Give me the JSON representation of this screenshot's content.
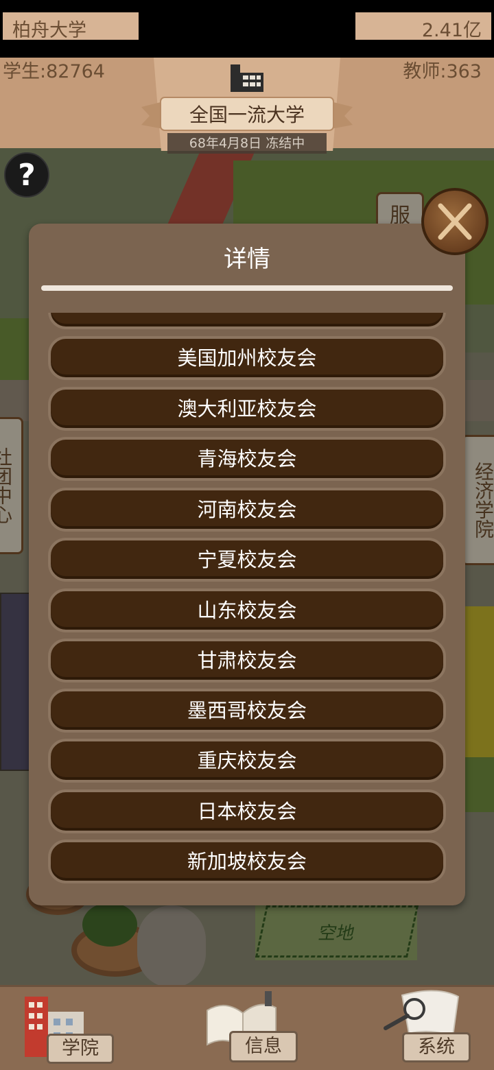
{
  "hud": {
    "university_name": "柏舟大学",
    "money": "2.41亿",
    "students": "学生:82764",
    "teachers": "教师:363",
    "rank": "全国一流大学",
    "date_status": "68年4月8日 冻结中"
  },
  "help_label": "?",
  "map_signs": {
    "sign_top": "服",
    "sign_left": "社团中心",
    "sign_right": "经济学院",
    "plot": "空地"
  },
  "modal": {
    "title": "详情",
    "items": [
      "",
      "美国加州校友会",
      "澳大利亚校友会",
      "青海校友会",
      "河南校友会",
      "宁夏校友会",
      "山东校友会",
      "甘肃校友会",
      "墨西哥校友会",
      "重庆校友会",
      "日本校友会",
      "新加坡校友会"
    ]
  },
  "bottom_nav": {
    "college": "学院",
    "info": "信息",
    "system": "系统"
  },
  "colors": {
    "hud_bg": "#c49b79",
    "modal_bg": "#7b6450",
    "item_bg": "#412710",
    "nav_bg": "#8a6b52"
  }
}
